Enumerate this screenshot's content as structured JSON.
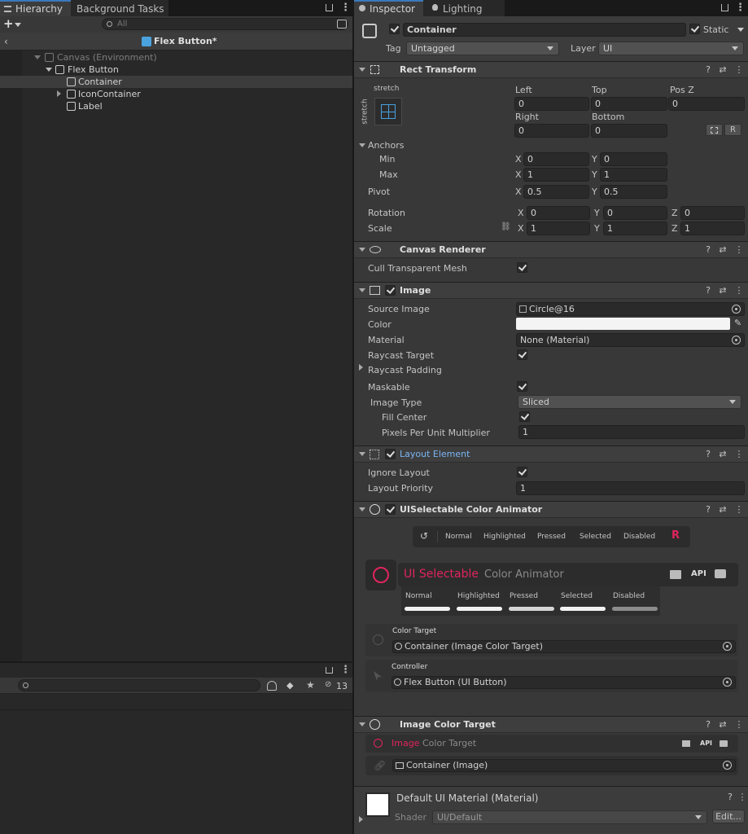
{
  "hierarchy": {
    "tabs": [
      "Hierarchy",
      "Background Tasks"
    ],
    "search_placeholder": "All",
    "scene_title": "Flex Button*",
    "tree": [
      {
        "label": "Canvas (Environment)"
      },
      {
        "label": "Flex Button"
      },
      {
        "label": "Container"
      },
      {
        "label": "IconContainer"
      },
      {
        "label": "Label"
      }
    ],
    "bottom_badge": "13"
  },
  "inspector": {
    "tabs": [
      "Inspector",
      "Lighting"
    ],
    "object_name": "Container",
    "static_label": "Static",
    "tag_label": "Tag",
    "tag_value": "Untagged",
    "layer_label": "Layer",
    "layer_value": "UI",
    "rect_transform": {
      "title": "Rect Transform",
      "anchor_preset_top": "stretch",
      "anchor_preset_side": "stretch",
      "left_label": "Left",
      "left": "0",
      "top_label": "Top",
      "top": "0",
      "posz_label": "Pos Z",
      "posz": "0",
      "right_label": "Right",
      "right": "0",
      "bottom_label": "Bottom",
      "bottom": "0",
      "r_button": "R",
      "anchors_label": "Anchors",
      "min_label": "Min",
      "min_x": "0",
      "min_y": "0",
      "max_label": "Max",
      "max_x": "1",
      "max_y": "1",
      "pivot_label": "Pivot",
      "pivot_x": "0.5",
      "pivot_y": "0.5",
      "rotation_label": "Rotation",
      "rot_x": "0",
      "rot_y": "0",
      "rot_z": "0",
      "scale_label": "Scale",
      "scale_x": "1",
      "scale_y": "1",
      "scale_z": "1",
      "x": "X",
      "y": "Y",
      "z": "Z"
    },
    "canvas_renderer": {
      "title": "Canvas Renderer",
      "cull_label": "Cull Transparent Mesh"
    },
    "image": {
      "title": "Image",
      "source_label": "Source Image",
      "source_value": "Circle@16",
      "color_label": "Color",
      "color_value": "#f4f4f4",
      "material_label": "Material",
      "material_value": "None (Material)",
      "raycast_label": "Raycast Target",
      "padding_label": "Raycast Padding",
      "maskable_label": "Maskable",
      "type_label": "Image Type",
      "type_value": "Sliced",
      "fill_label": "Fill Center",
      "ppu_label": "Pixels Per Unit Multiplier",
      "ppu_value": "1"
    },
    "layout_element": {
      "title": "Layout Element",
      "ignore_label": "Ignore Layout",
      "priority_label": "Layout Priority",
      "priority_value": "1"
    },
    "color_animator": {
      "title": "UISelectable Color Animator",
      "state_tabs": [
        "Normal",
        "Highlighted",
        "Pressed",
        "Selected",
        "Disabled"
      ],
      "banner_title_a": "UI Selectable",
      "banner_title_b": "Color Animator",
      "api_label": "API",
      "swatch_labels": [
        "Normal",
        "Highlighted",
        "Pressed",
        "Selected",
        "Disabled"
      ],
      "color_target_label": "Color Target",
      "color_target_value": "Container (Image Color Target)",
      "controller_label": "Controller",
      "controller_value": "Flex Button (UI Button)"
    },
    "image_color_target": {
      "title": "Image Color Target",
      "banner_a": "Image",
      "banner_b": "Color Target",
      "api_label": "API",
      "target_value": "Container (Image)"
    },
    "material": {
      "title": "Default UI Material (Material)",
      "shader_label": "Shader",
      "shader_value": "UI/Default",
      "edit_label": "Edit..."
    }
  },
  "colors": {
    "accent_red": "#e0245e",
    "link_blue": "#7bb6f5",
    "tab_underline": "#3a79bb"
  }
}
